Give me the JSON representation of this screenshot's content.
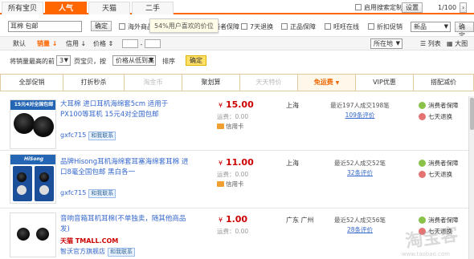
{
  "tabs": {
    "items": [
      {
        "label": "所有宝贝"
      },
      {
        "label": "人气"
      },
      {
        "label": "天猫"
      },
      {
        "label": "二手"
      }
    ],
    "custom_search_label": "启用搜索定制",
    "settings_label": "设置",
    "pagination": "1/100"
  },
  "search": {
    "query": "耳棉 包邮",
    "confirm_label": "确定",
    "tooltip": "54%用户喜欢的价位",
    "filters": [
      {
        "label": "海外商品"
      },
      {
        "label": "消费者保障"
      },
      {
        "label": "7天退换"
      },
      {
        "label": "正品保障"
      },
      {
        "label": "旺旺在线"
      },
      {
        "label": "折扣促销"
      }
    ],
    "sort_select": "新品",
    "small_confirm": "确定"
  },
  "sort_bar": {
    "default_label": "默认",
    "sales_label": "销量",
    "credit_label": "信用",
    "price_label": "价格",
    "location_select": "所在地",
    "view_list_label": "列表",
    "view_grid_label": "大图"
  },
  "price_row": {
    "prefix": "将销量最高的前",
    "count": "3",
    "middle": "页宝贝，按",
    "order_select": "价格从低到高",
    "suffix": "排序",
    "confirm_label": "确定"
  },
  "categories": [
    {
      "label": "全部促销",
      "state": "normal"
    },
    {
      "label": "打折秒杀",
      "state": "normal"
    },
    {
      "label": "淘金币",
      "state": "disabled"
    },
    {
      "label": "聚划算",
      "state": "normal"
    },
    {
      "label": "天天特价",
      "state": "disabled"
    },
    {
      "label": "免运费",
      "state": "active"
    },
    {
      "label": "VIP优惠",
      "state": "normal"
    },
    {
      "label": "搭配减价",
      "state": "normal"
    }
  ],
  "items": [
    {
      "thumb_label": "15元4对全国包邮",
      "title": "大耳棉 进口耳机海绵套5cm 适用于PX100等耳机 15元4对全国包邮",
      "seller": "gxfc715",
      "ww_label": "和我联系",
      "price": "15.00",
      "yen": "¥",
      "shipping": "运费：0.00",
      "card": "信用卡",
      "location": "上海",
      "deal": "最近197人成交198笔",
      "reviews": "109条评价",
      "services": [
        "消费者保障",
        "七天退换"
      ]
    },
    {
      "thumb_label": "HiSong",
      "title": "品牌Hisong耳机海绵套耳塞海绵套耳棉 进口8毫全国包邮 黑白各一",
      "seller": "gxfc715",
      "ww_label": "和我联系",
      "price": "11.00",
      "yen": "¥",
      "shipping": "运费：0.00",
      "card": "信用卡",
      "location": "上海",
      "deal": "最近52人成交52笔",
      "reviews": "32条评价",
      "services": [
        "消费者保障",
        "七天退换"
      ]
    },
    {
      "thumb_label": "",
      "title": "音响音箱耳机耳棉(不单独卖，随其他商品发)",
      "tmall": "天猫 TMALL.COM",
      "seller": "智沃官方旗舰店",
      "ww_label": "和我联系",
      "price": "1.00",
      "yen": "¥",
      "shipping": "运费：0.00",
      "card": "",
      "location": "广东 广州",
      "deal": "最近52人成交56笔",
      "reviews": "28条评价",
      "services": [
        "消费者保障",
        "七天退换"
      ]
    }
  ],
  "watermark": "淘宝客",
  "watermark_url": "www.taobao.com",
  "colors": {
    "accent": "#ff6600",
    "price": "#cc0000",
    "link": "#3366cc"
  }
}
